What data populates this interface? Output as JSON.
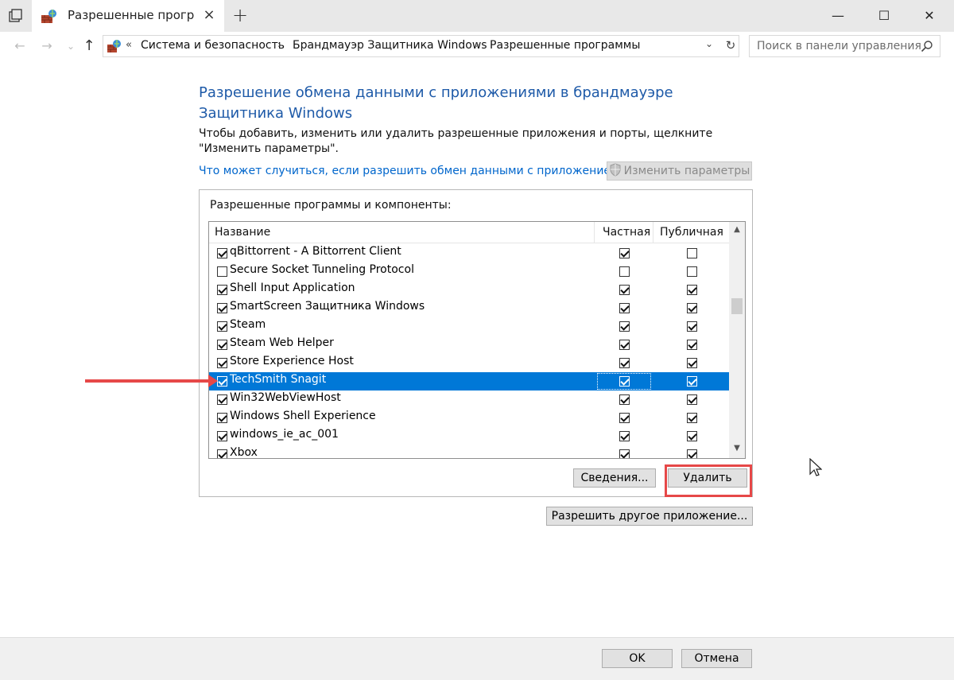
{
  "window": {
    "tab_title": "Разрешенные програ",
    "close_tab": "×",
    "new_tab": "+",
    "minimize": "—",
    "maximize": "☐",
    "close": "✕"
  },
  "nav": {
    "back": "←",
    "forward": "→",
    "recent": "⌄",
    "up": "↑"
  },
  "address": {
    "overflow": "«",
    "crumbs": [
      "Система и безопасность",
      "Брандмауэр Защитника Windows",
      "Разрешенные программы"
    ],
    "separator": "›",
    "dropdown": "⌄",
    "refresh": "↻"
  },
  "search": {
    "placeholder": "Поиск в панели управления"
  },
  "main": {
    "heading": "Разрешение обмена данными с приложениями в брандмауэре Защитника Windows",
    "description": "Чтобы добавить, изменить или удалить разрешенные приложения и порты, щелкните \"Изменить параметры\".",
    "link": "Что может случиться, если разрешить обмен данными с приложением?",
    "change_settings": "Изменить параметры",
    "group_label": "Разрешенные программы и компоненты:",
    "columns": {
      "name": "Название",
      "private": "Частная",
      "public": "Публичная"
    },
    "rows": [
      {
        "name": "qBittorrent - A Bittorrent Client",
        "enabled": true,
        "private": true,
        "public": false
      },
      {
        "name": "Secure Socket Tunneling Protocol",
        "enabled": false,
        "private": false,
        "public": false
      },
      {
        "name": "Shell Input Application",
        "enabled": true,
        "private": true,
        "public": true
      },
      {
        "name": "SmartScreen Защитника Windows",
        "enabled": true,
        "private": true,
        "public": true
      },
      {
        "name": "Steam",
        "enabled": true,
        "private": true,
        "public": true
      },
      {
        "name": "Steam Web Helper",
        "enabled": true,
        "private": true,
        "public": true
      },
      {
        "name": "Store Experience Host",
        "enabled": true,
        "private": true,
        "public": true
      },
      {
        "name": "TechSmith Snagit",
        "enabled": true,
        "private": true,
        "public": true,
        "selected": true
      },
      {
        "name": "Win32WebViewHost",
        "enabled": true,
        "private": true,
        "public": true
      },
      {
        "name": "Windows Shell Experience",
        "enabled": true,
        "private": true,
        "public": true
      },
      {
        "name": "windows_ie_ac_001",
        "enabled": true,
        "private": true,
        "public": true
      },
      {
        "name": "Xbox",
        "enabled": true,
        "private": true,
        "public": true
      }
    ],
    "scroll_up": "▲",
    "scroll_down": "▼",
    "details_button": "Сведения...",
    "remove_button": "Удалить",
    "allow_other_button": "Разрешить другое приложение..."
  },
  "footer": {
    "ok": "OK",
    "cancel": "Отмена"
  },
  "colors": {
    "accent": "#0078d7",
    "heading": "#1e5aa8",
    "link": "#0066cc",
    "annotation": "#e64848"
  }
}
